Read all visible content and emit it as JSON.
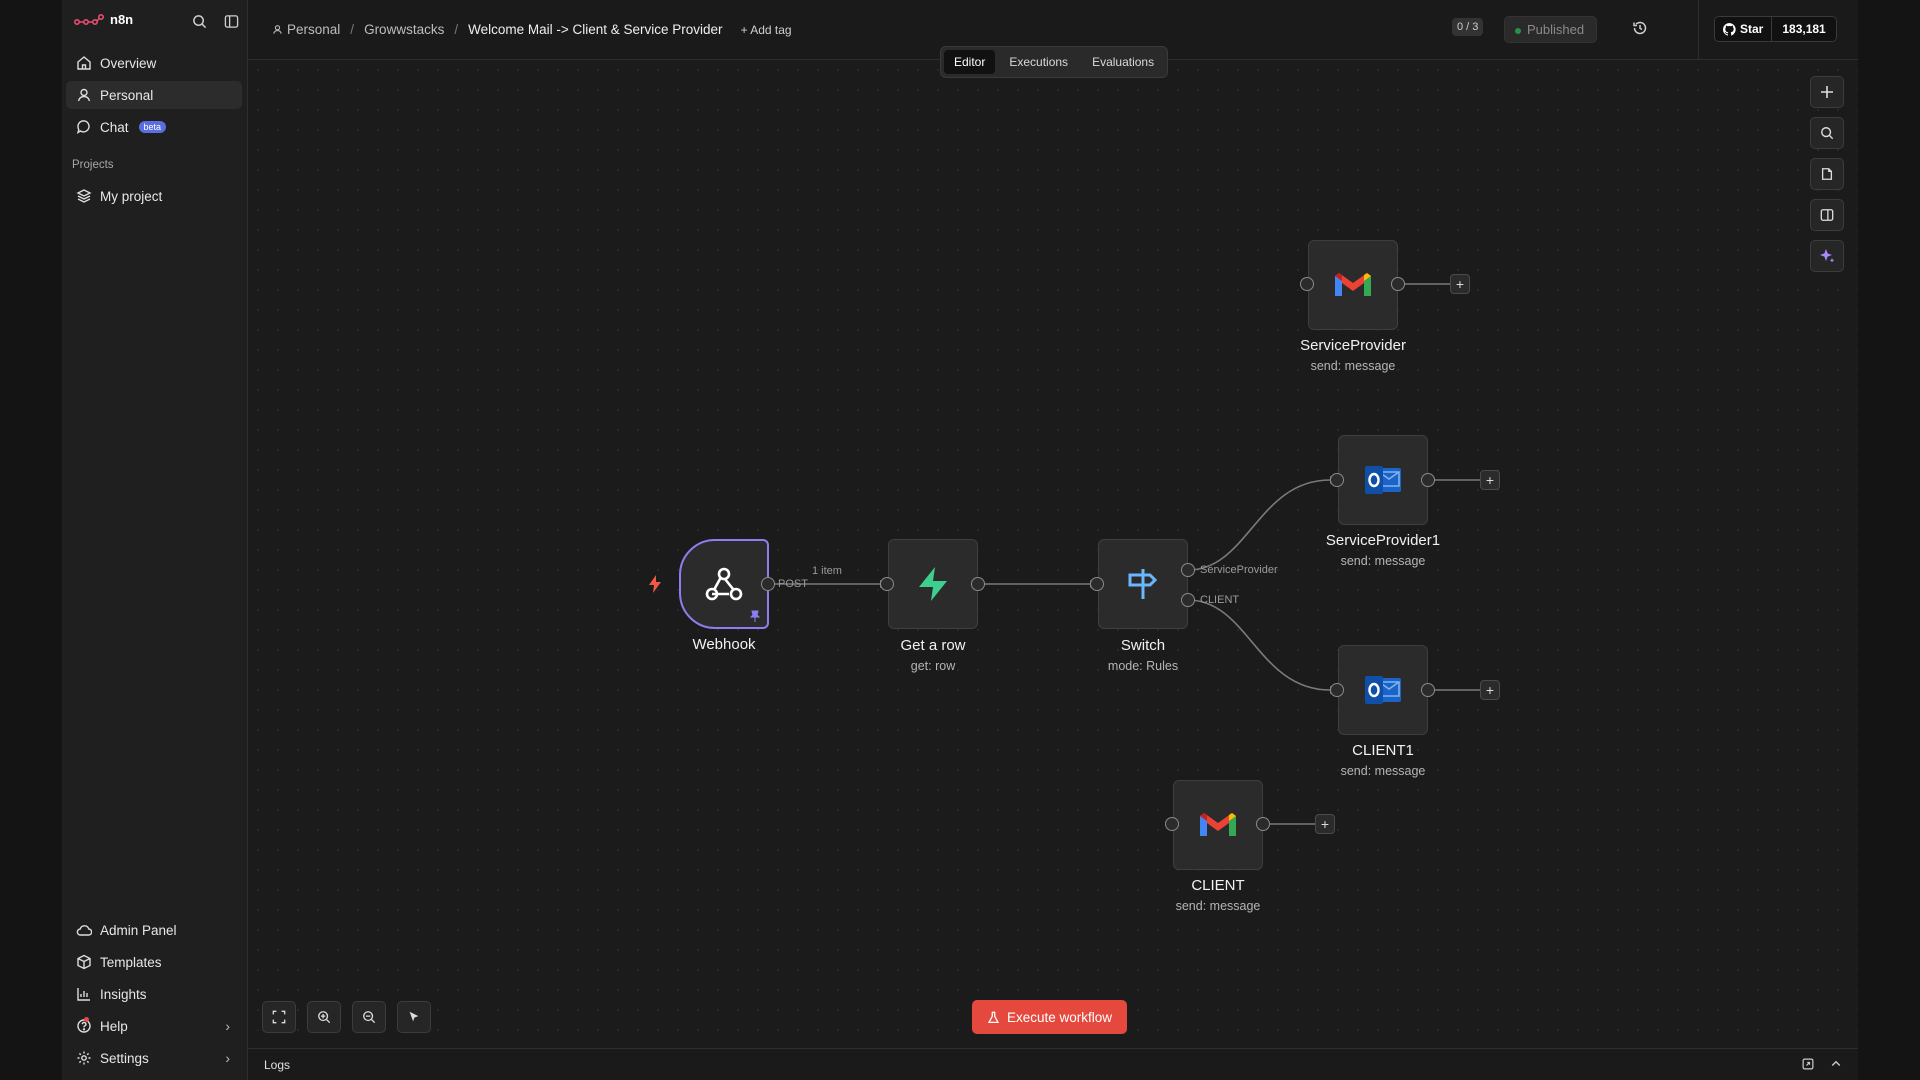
{
  "app": {
    "name": "n8n"
  },
  "sidebar": {
    "top_items": [
      {
        "label": "Overview",
        "icon": "home-icon"
      },
      {
        "label": "Personal",
        "icon": "user-icon"
      },
      {
        "label": "Chat",
        "icon": "chat-icon",
        "badge": "beta"
      }
    ],
    "projects_label": "Projects",
    "project_items": [
      {
        "label": "My project",
        "icon": "layers-icon"
      }
    ],
    "bottom_items": [
      {
        "label": "Admin Panel",
        "icon": "cloud-icon"
      },
      {
        "label": "Templates",
        "icon": "box-icon"
      },
      {
        "label": "Insights",
        "icon": "chart-icon"
      },
      {
        "label": "Help",
        "icon": "help-icon"
      },
      {
        "label": "Settings",
        "icon": "gear-icon"
      }
    ]
  },
  "header": {
    "breadcrumbs": [
      "Personal",
      "Growwstacks",
      "Welcome Mail -> Client & Service Provider"
    ],
    "add_tag": "+ Add tag",
    "counter": "0 / 3",
    "status": "Published",
    "github": {
      "star_label": "Star",
      "count": "183,181"
    }
  },
  "tabs": [
    "Editor",
    "Executions",
    "Evaluations"
  ],
  "active_tab": "Editor",
  "nodes": [
    {
      "id": "webhook",
      "label": "Webhook",
      "sub": ""
    },
    {
      "id": "get-a-row",
      "label": "Get a row",
      "sub": "get: row"
    },
    {
      "id": "switch",
      "label": "Switch",
      "sub": "mode: Rules"
    },
    {
      "id": "service-provider",
      "label": "ServiceProvider",
      "sub": "send: message"
    },
    {
      "id": "service-provider1",
      "label": "ServiceProvider1",
      "sub": "send: message"
    },
    {
      "id": "client1",
      "label": "CLIENT1",
      "sub": "send: message"
    },
    {
      "id": "client",
      "label": "CLIENT",
      "sub": "send: message"
    }
  ],
  "edge_labels": {
    "webhook_out": "POST",
    "items": "1 item",
    "switch_out1": "ServiceProvider",
    "switch_out2": "CLIENT"
  },
  "execute_label": "Execute workflow",
  "logs_label": "Logs",
  "colors": {
    "accent_red": "#e5483d",
    "webhook_border": "#8b7ff0",
    "beta_badge": "#5b6ee0"
  }
}
